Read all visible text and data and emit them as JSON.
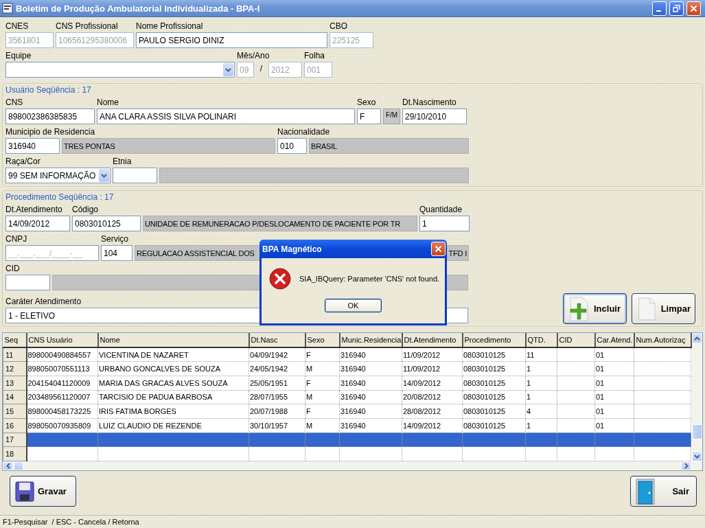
{
  "window": {
    "title": "Boletim de Produção Ambulatorial Individualizada - BPA-I"
  },
  "header": {
    "rows": [
      [
        {
          "kind": "input",
          "label": "CNES",
          "value": "3561801",
          "disabled": true
        },
        {
          "kind": "input",
          "label": "CNS Profissional",
          "value": "106561295380006",
          "disabled": true
        },
        {
          "kind": "input",
          "label": "Nome Profissional",
          "value": "PAULO SERGIO DINIZ",
          "disabled": false
        },
        {
          "kind": "input",
          "label": "CBO",
          "value": "225125",
          "disabled": true
        }
      ],
      [
        {
          "kind": "select",
          "label": "Equipe"
        },
        {
          "kind": "input",
          "label": "Mês/Ano",
          "value": "09",
          "disabled": true
        },
        {
          "kind": "slash",
          "value": "/"
        },
        {
          "kind": "input",
          "value": "2012",
          "disabled": true
        },
        {
          "kind": "input",
          "label": "Folha",
          "value": "001",
          "disabled": true
        }
      ]
    ]
  },
  "usuario": {
    "legend": "Usuário Seqüência : 17",
    "rows": [
      [
        {
          "kind": "input",
          "label": "CNS",
          "value": "898002386385835",
          "disabled": false
        },
        {
          "kind": "input",
          "label": "Nome",
          "value": "ANA CLARA ASSIS SILVA POLINARI",
          "disabled": false
        },
        {
          "kind": "input",
          "label": "Sexo",
          "value": "F",
          "disabled": false
        },
        {
          "kind": "button",
          "value": "F/M"
        },
        {
          "kind": "input",
          "label": "Dt.Nascimento",
          "value": "29/10/2010",
          "disabled": false
        }
      ],
      [
        {
          "kind": "input",
          "label": "Municipio de Residencia",
          "value": "316940",
          "disabled": false
        },
        {
          "kind": "display",
          "value": "TRES PONTAS"
        },
        {
          "kind": "input",
          "label": "Nacionalidade",
          "value": "010",
          "disabled": false
        },
        {
          "kind": "display",
          "value": "BRASIL"
        }
      ],
      [
        {
          "kind": "select",
          "label": "Raça/Cor",
          "value": "99 SEM INFORMAÇÃO"
        },
        {
          "kind": "input",
          "label": "Etnia",
          "disabled": false
        },
        {
          "kind": "display"
        }
      ]
    ]
  },
  "procedimento": {
    "legend": "Procedimento Seqüência : 17",
    "rows": [
      [
        {
          "kind": "input",
          "label": "Dt.Atendimento",
          "value": "14/09/2012",
          "disabled": false
        },
        {
          "kind": "input",
          "label": "Código",
          "value": "0803010125",
          "disabled": false
        },
        {
          "kind": "display",
          "value": "UNIDADE DE REMUNERACAO P/DESLOCAMENTO DE PACIENTE POR TR"
        },
        {
          "kind": "input",
          "label": "Quantidade",
          "value": "1",
          "disabled": false
        }
      ],
      [
        {
          "kind": "mask",
          "label": "CNPJ",
          "placeholder": "__.___.___/____-__"
        },
        {
          "kind": "input",
          "label": "Serviço",
          "value": "104",
          "disabled": false
        },
        {
          "kind": "display",
          "value": "REGULACAO ASSISTENCIAL DOS",
          "value_end": "TFD I"
        }
      ],
      [
        {
          "kind": "input",
          "label": "CID",
          "disabled": false
        },
        {
          "kind": "display"
        }
      ],
      [
        {
          "kind": "input",
          "label": "Caráter Atendimento",
          "value": "1 - ELETIVO",
          "disabled": false
        }
      ]
    ],
    "buttons": [
      {
        "kind": "add",
        "label": "Incluir"
      },
      {
        "kind": "clear",
        "label": "Limpar"
      }
    ]
  },
  "table": {
    "columns": [
      "Seq",
      "CNS Usuário",
      "Nome",
      "Dt.Nasc",
      "Sexo",
      "Munic.Residencia",
      "Dt.Atendimento",
      "Procedimento",
      "QTD.",
      "CID",
      "Car.Atend.",
      "Num.Autorizaç"
    ],
    "rows": [
      {
        "selected": false,
        "cells": [
          "11",
          "898000490884557",
          "VICENTINA DE NAZARET",
          "04/09/1942",
          "F",
          "316940",
          "11/09/2012",
          "0803010125",
          "11",
          "",
          "01",
          ""
        ]
      },
      {
        "selected": false,
        "cells": [
          "12",
          "898050070551113",
          "URBANO GONCALVES DE SOUZA",
          "24/05/1942",
          "M",
          "316940",
          "11/09/2012",
          "0803010125",
          "1",
          "",
          "01",
          ""
        ]
      },
      {
        "selected": false,
        "cells": [
          "13",
          "204154041120009",
          "MARIA DAS GRACAS ALVES SOUZA",
          "25/05/1951",
          "F",
          "316940",
          "14/09/2012",
          "0803010125",
          "1",
          "",
          "01",
          ""
        ]
      },
      {
        "selected": false,
        "cells": [
          "14",
          "203489561120007",
          "TARCISIO DE PADUA BARBOSA",
          "28/07/1955",
          "M",
          "316940",
          "20/08/2012",
          "0803010125",
          "1",
          "",
          "01",
          ""
        ]
      },
      {
        "selected": false,
        "cells": [
          "15",
          "898000458173225",
          "IRIS FATIMA BORGES",
          "20/07/1988",
          "F",
          "316940",
          "28/08/2012",
          "0803010125",
          "4",
          "",
          "01",
          ""
        ]
      },
      {
        "selected": false,
        "cells": [
          "16",
          "898050070935809",
          "LUIZ CLAUDIO DE REZENDE",
          "30/10/1957",
          "M",
          "316940",
          "14/09/2012",
          "0803010125",
          "1",
          "",
          "01",
          ""
        ]
      },
      {
        "selected": true,
        "cells": [
          "17"
        ]
      },
      {
        "selected": false,
        "cells": [
          "18"
        ]
      }
    ]
  },
  "footer_buttons": [
    {
      "kind": "save",
      "label": "Gravar"
    },
    {
      "kind": "exit",
      "label": "Sair"
    }
  ],
  "status_bar": "F1-Pesquisar  / ESC - Cancela / Retorna",
  "dialog": {
    "title": "BPA Magnético",
    "kind": "error",
    "message": "SIA_IBQuery: Parameter 'CNS' not found.",
    "button": "OK"
  }
}
